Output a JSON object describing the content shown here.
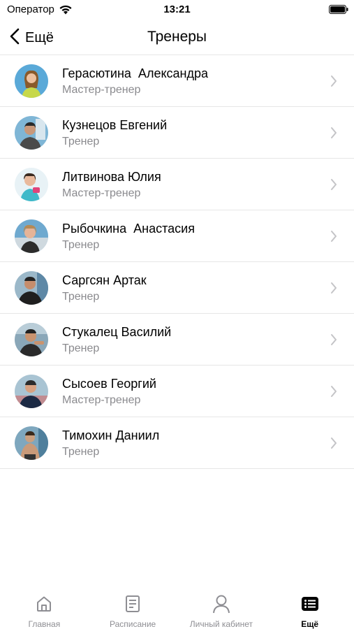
{
  "status_bar": {
    "carrier": "Оператор",
    "time": "13:21"
  },
  "nav": {
    "back_label": "Ещё",
    "title": "Тренеры"
  },
  "trainers": [
    {
      "name": "Герасютина  Александра",
      "role": "Мастер-тренер"
    },
    {
      "name": "Кузнецов Евгений",
      "role": "Тренер"
    },
    {
      "name": "Литвинова Юлия",
      "role": "Мастер-тренер"
    },
    {
      "name": "Рыбочкина  Анастасия",
      "role": "Тренер"
    },
    {
      "name": "Саргсян Артак",
      "role": "Тренер"
    },
    {
      "name": "Стукалец Василий",
      "role": "Тренер"
    },
    {
      "name": "Сысоев Георгий",
      "role": "Мастер-тренер"
    },
    {
      "name": "Тимохин Даниил",
      "role": "Тренер"
    }
  ],
  "tabs": [
    {
      "label": "Главная",
      "icon": "home-icon",
      "active": false
    },
    {
      "label": "Расписание",
      "icon": "schedule-icon",
      "active": false
    },
    {
      "label": "Личный кабинет",
      "icon": "profile-icon",
      "active": false
    },
    {
      "label": "Ещё",
      "icon": "more-list-icon",
      "active": true
    }
  ],
  "colors": {
    "secondary_text": "#8a8a8e",
    "separator": "#e6e6e6",
    "chevron": "#c4c4c7",
    "tab_inactive": "#8e8e93"
  }
}
